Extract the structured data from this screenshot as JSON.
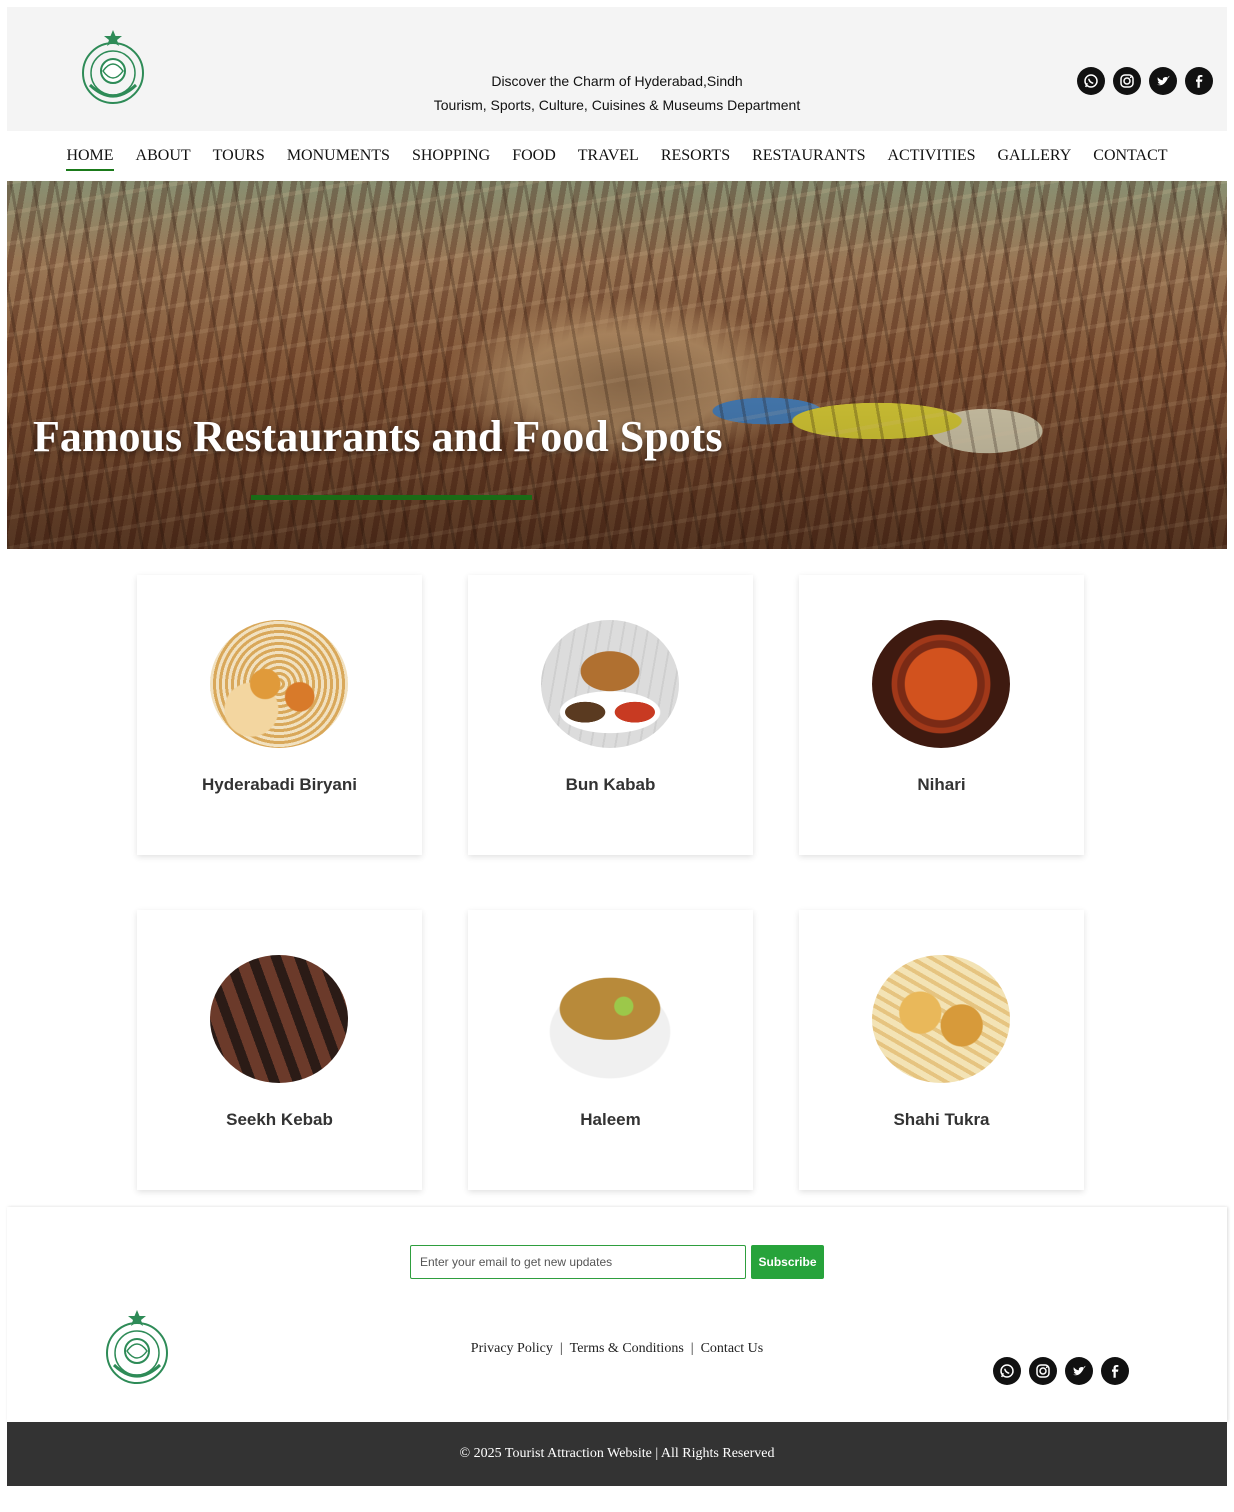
{
  "header": {
    "tagline_line1": "Discover the Charm of Hyderabad,Sindh",
    "tagline_line2": "Tourism, Sports, Culture, Cuisines & Museums Department",
    "social": [
      "whatsapp-icon",
      "instagram-icon",
      "twitter-icon",
      "facebook-icon"
    ]
  },
  "nav": {
    "items": [
      "HOME",
      "ABOUT",
      "TOURS",
      "MONUMENTS",
      "SHOPPING",
      "FOOD",
      "TRAVEL",
      "RESORTS",
      "RESTAURANTS",
      "ACTIVITIES",
      "GALLERY",
      "CONTACT"
    ],
    "active": "HOME"
  },
  "hero": {
    "title": "Famous Restaurants and Food Spots",
    "accent_color": "#1a6b16"
  },
  "cards": [
    {
      "name": "Hyderabadi Biryani"
    },
    {
      "name": "Bun Kabab"
    },
    {
      "name": "Nihari"
    },
    {
      "name": "Seekh Kebab"
    },
    {
      "name": "Haleem"
    },
    {
      "name": "Shahi Tukra"
    }
  ],
  "footer": {
    "subscribe": {
      "placeholder": "Enter your email to get new updates",
      "button": "Subscribe",
      "button_color": "#27a33b"
    },
    "links": [
      "Privacy Policy",
      "Terms & Conditions",
      "Contact Us"
    ],
    "copyright": "© 2025 Tourist Attraction Website | All Rights Reserved"
  }
}
